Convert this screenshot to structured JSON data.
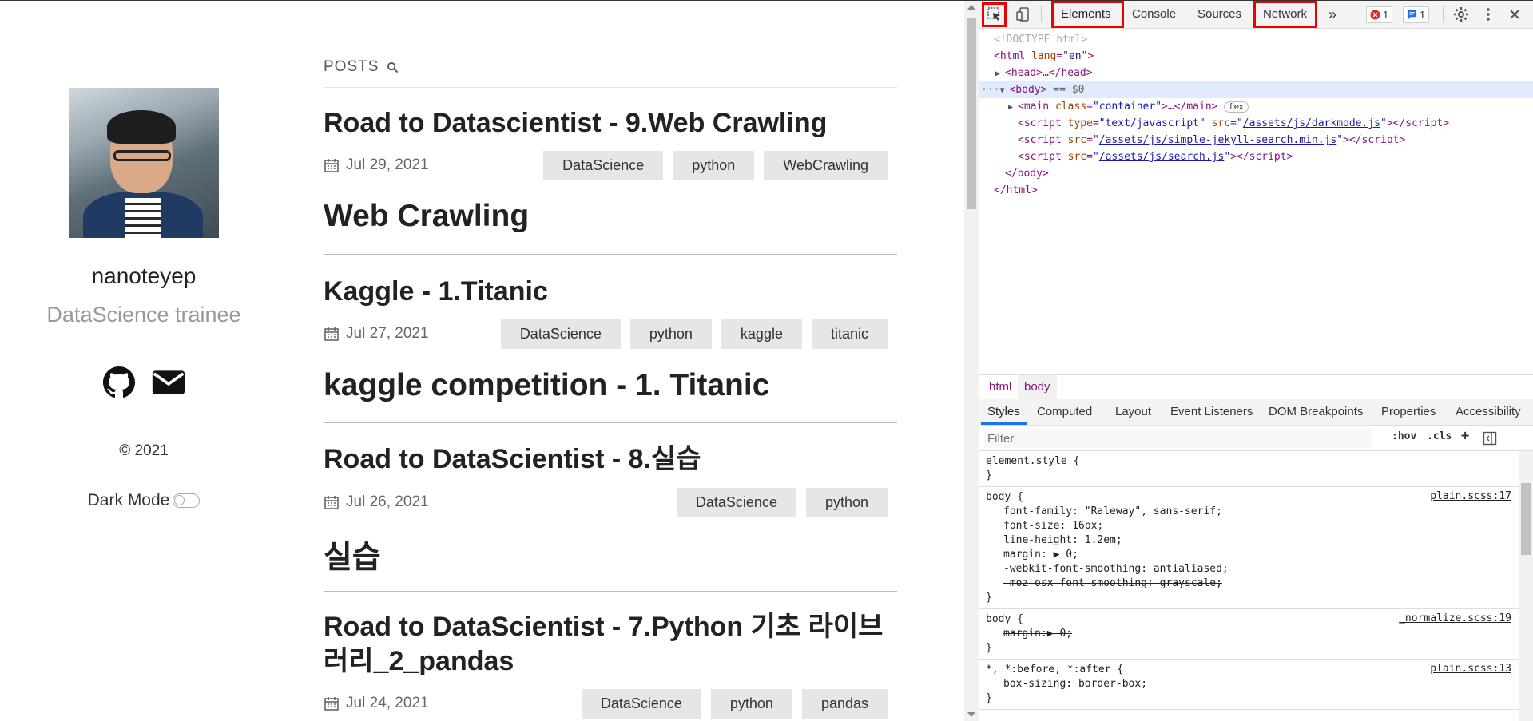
{
  "sidebar": {
    "name": "nanoteyep",
    "role": "DataScience trainee",
    "copyright": "© 2021",
    "dark_mode_label": "Dark Mode"
  },
  "main": {
    "posts_label": "POSTS",
    "posts": [
      {
        "title": "Road to Datascientist - 9.Web Crawling",
        "date": "Jul 29, 2021",
        "tags": [
          "DataScience",
          "python",
          "WebCrawling"
        ],
        "subtitle": "Web Crawling"
      },
      {
        "title": "Kaggle - 1.Titanic",
        "date": "Jul 27, 2021",
        "tags": [
          "DataScience",
          "python",
          "kaggle",
          "titanic"
        ],
        "subtitle": "kaggle competition - 1. Titanic"
      },
      {
        "title": "Road to DataScientist - 8.실습",
        "date": "Jul 26, 2021",
        "tags": [
          "DataScience",
          "python"
        ],
        "subtitle": "실습"
      },
      {
        "title": "Road to DataScientist - 7.Python 기초 라이브러리_2_pandas",
        "date": "Jul 24, 2021",
        "tags": [
          "DataScience",
          "python",
          "pandas"
        ],
        "subtitle": ""
      }
    ]
  },
  "devtools": {
    "tabs": [
      "Elements",
      "Console",
      "Sources",
      "Network"
    ],
    "more_tabs": "»",
    "error_count": "1",
    "message_count": "1",
    "dom": {
      "doctype": "<!DOCTYPE html>",
      "html_open": "html",
      "lang_attr": "lang",
      "lang_val": "\"en\"",
      "head": "<head>…</head>",
      "body_open": "<body>",
      "body_marker": "== $0",
      "main_tag": "main",
      "main_class_attr": "class",
      "main_class_val": "\"container\"",
      "main_rest": ">…</main>",
      "flex_badge": "flex",
      "script1_type_attr": "type",
      "script1_type_val": "\"text/javascript\"",
      "script1_src": "/assets/js/darkmode.js",
      "script2_src": "/assets/js/simple-jekyll-search.min.js",
      "script3_src": "/assets/js/search.js",
      "body_close": "</body>",
      "html_close": "</html>"
    },
    "breadcrumbs": [
      "html",
      "body"
    ],
    "subtabs": [
      "Styles",
      "Computed",
      "Layout",
      "Event Listeners",
      "DOM Breakpoints",
      "Properties",
      "Accessibility"
    ],
    "filter_placeholder": "Filter",
    "filter_options": [
      ":hov",
      ".cls",
      "+"
    ],
    "styles": {
      "element_style_selector": "element.style {",
      "close": "}",
      "rule1_selector": "body {",
      "rule1_source": "plain.scss:17",
      "rule1_props": [
        {
          "name": "font-family",
          "value": "\"Raleway\", sans-serif;"
        },
        {
          "name": "font-size",
          "value": "16px;"
        },
        {
          "name": "line-height",
          "value": "1.2em;"
        },
        {
          "name": "margin",
          "value": "▶ 0;"
        },
        {
          "name": "-webkit-font-smoothing",
          "value": "antialiased;"
        }
      ],
      "rule1_struck": "-moz-osx-font-smoothing: grayscale;",
      "rule2_selector": "body {",
      "rule2_source": "_normalize.scss:19",
      "rule2_struck": "margin:▶ 0;",
      "rule3_selector": "*, *:before, *:after {",
      "rule3_source": "plain.scss:13",
      "rule3_prop_name": "box-sizing",
      "rule3_prop_value": "border-box;"
    }
  },
  "colors": {
    "highlight_box": "#e00000",
    "tab_active_underline": "#1a73e8",
    "tag_bg": "#e6e6e6"
  }
}
